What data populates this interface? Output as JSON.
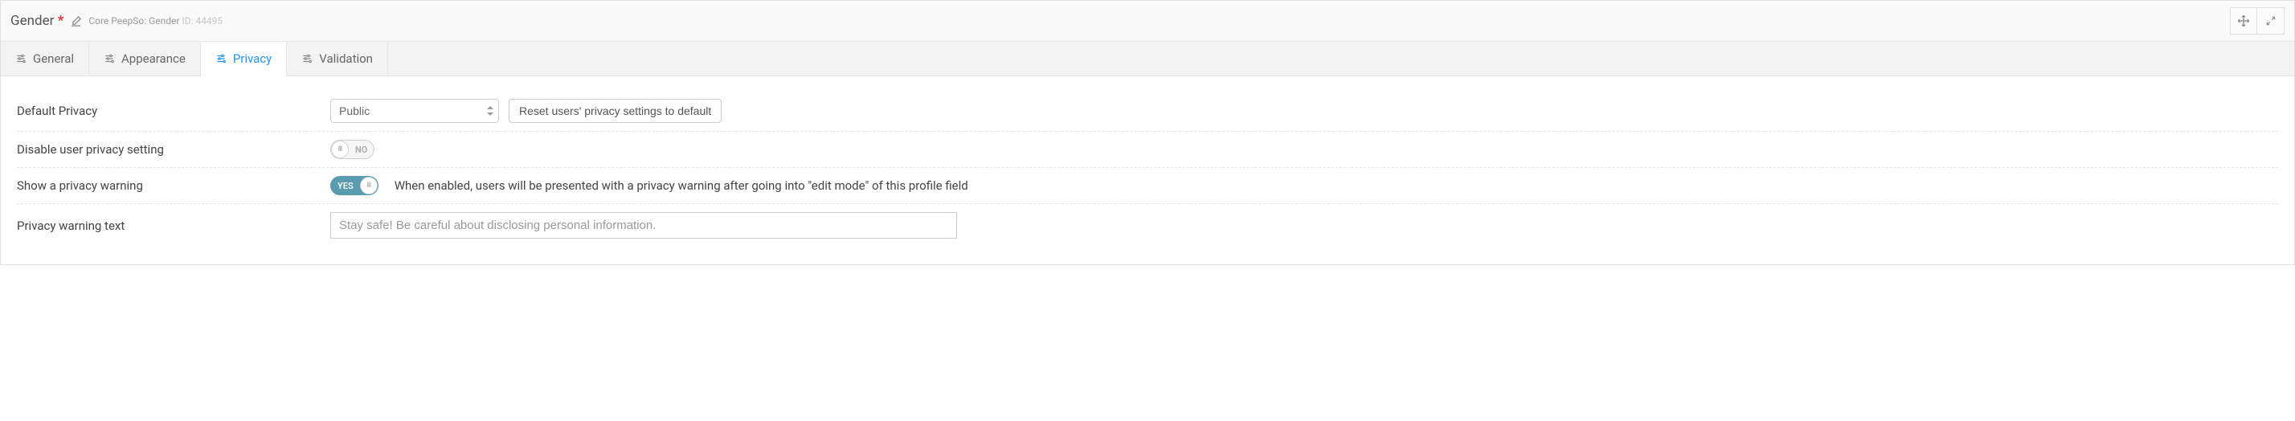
{
  "header": {
    "title": "Gender",
    "required_mark": "*",
    "meta_prefix": "Core PeepSo: Gender",
    "id_label": "ID: 44495"
  },
  "tabs": [
    {
      "label": "General",
      "active": false
    },
    {
      "label": "Appearance",
      "active": false
    },
    {
      "label": "Privacy",
      "active": true
    },
    {
      "label": "Validation",
      "active": false
    }
  ],
  "fields": {
    "default_privacy": {
      "label": "Default Privacy",
      "value": "Public",
      "reset_button": "Reset users' privacy settings to default"
    },
    "disable_user_privacy": {
      "label": "Disable user privacy setting",
      "toggle": {
        "state": "off",
        "text": "NO"
      }
    },
    "show_privacy_warning": {
      "label": "Show a privacy warning",
      "toggle": {
        "state": "on",
        "text": "YES"
      },
      "help": "When enabled, users will be presented with a privacy warning after going into \"edit mode\" of this profile field"
    },
    "privacy_warning_text": {
      "label": "Privacy warning text",
      "placeholder": "Stay safe! Be careful about disclosing personal information."
    }
  }
}
